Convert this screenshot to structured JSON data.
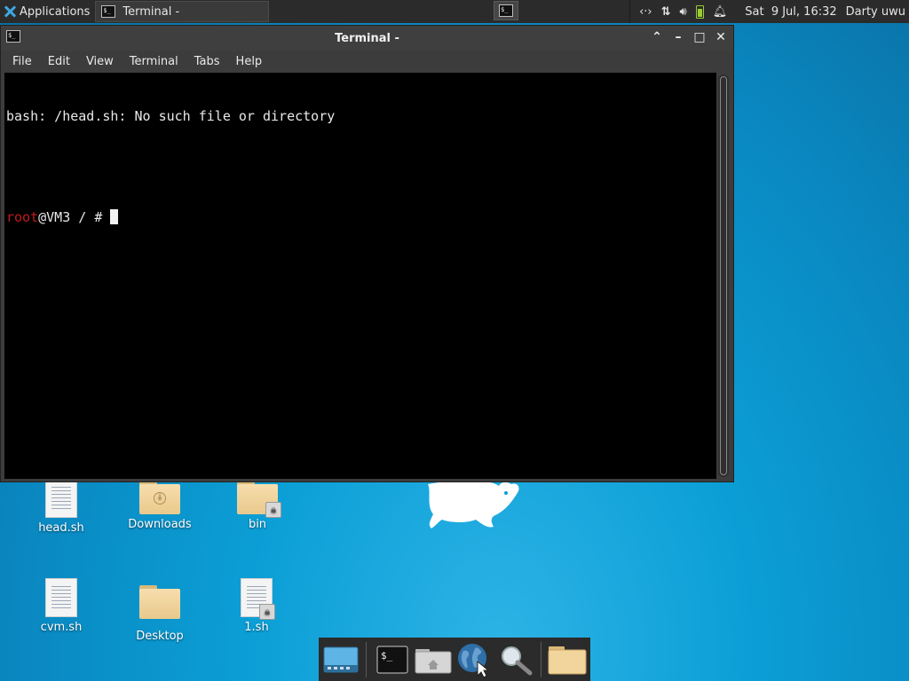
{
  "top_panel": {
    "applications_label": "Applications",
    "task_title": "Terminal -",
    "tray": {
      "network_icon": "network-icon",
      "transfer_icon": "transfer-icon",
      "volume_icon": "volume-icon",
      "battery_icon": "battery-icon",
      "notification_icon": "bell-icon"
    },
    "clock": "Sat  9 Jul, 16:32",
    "user": "Darty uwu"
  },
  "window": {
    "title": "Terminal -",
    "menu": [
      "File",
      "Edit",
      "View",
      "Terminal",
      "Tabs",
      "Help"
    ],
    "terminal": {
      "line1": "bash: /head.sh: No such file or directory",
      "prompt_user": "root",
      "prompt_rest": "@VM3 / # "
    },
    "colors": {
      "prompt_user": "#c21b1b",
      "background": "#000000"
    }
  },
  "desktop_icons": [
    {
      "label": "head.sh",
      "type": "document"
    },
    {
      "label": "Downloads",
      "type": "folder-download"
    },
    {
      "label": "bin",
      "type": "folder-locked"
    },
    {
      "label": "cvm.sh",
      "type": "document"
    },
    {
      "label": "Desktop",
      "type": "folder"
    },
    {
      "label": "1.sh",
      "type": "document-locked"
    }
  ],
  "dock": {
    "items": [
      "show-desktop-icon",
      "terminal-icon",
      "home-folder-icon",
      "web-browser-icon",
      "search-icon",
      "file-manager-icon"
    ]
  }
}
